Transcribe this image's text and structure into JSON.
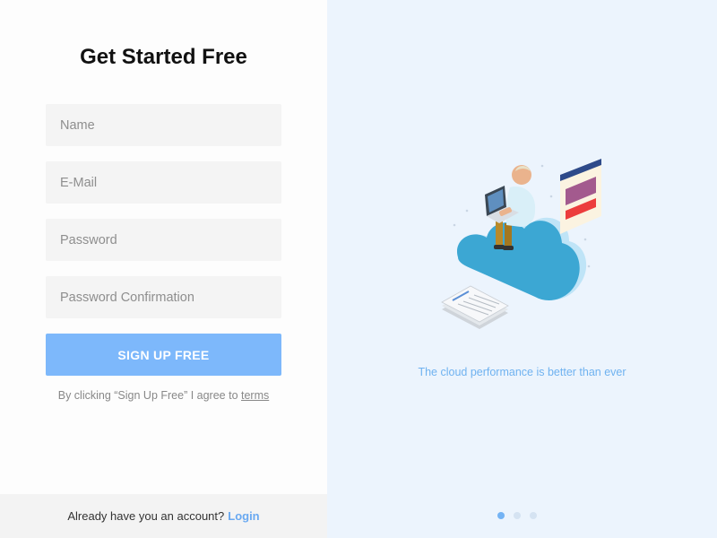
{
  "form": {
    "title": "Get Started Free",
    "name_placeholder": "Name",
    "email_placeholder": "E-Mail",
    "password_placeholder": "Password",
    "password_confirm_placeholder": "Password Confirmation",
    "signup_label": "SIGN UP FREE",
    "terms_prefix": "By clicking “Sign Up Free” I agree to ",
    "terms_link": "terms"
  },
  "footer": {
    "account_text": "Already have you an account?",
    "login_label": "Login"
  },
  "slide": {
    "caption": "The cloud performance is better than ever",
    "illustration": "person-on-cloud-with-laptop",
    "dots": [
      {
        "state": "active"
      },
      {
        "state": "inactive"
      },
      {
        "state": "inactive"
      }
    ]
  },
  "colors": {
    "accent": "#7db8fb",
    "link": "#6aa9f1",
    "caption": "#6fb2f0",
    "right_bg": "#ecf4fd"
  }
}
